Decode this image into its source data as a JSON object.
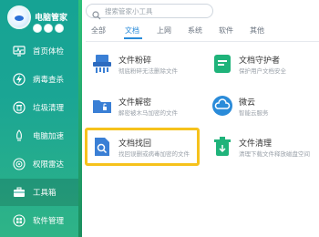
{
  "app": {
    "title": "电脑管家",
    "badge_count": 3
  },
  "sidebar": {
    "items": [
      {
        "label": "首页体检",
        "icon": "pulse-monitor-icon",
        "active": false
      },
      {
        "label": "病毒查杀",
        "icon": "lightning-icon",
        "active": false
      },
      {
        "label": "垃圾清理",
        "icon": "trash-icon",
        "active": false
      },
      {
        "label": "电脑加速",
        "icon": "rocket-icon",
        "active": false
      },
      {
        "label": "权限雷达",
        "icon": "radar-icon",
        "active": false
      },
      {
        "label": "工具箱",
        "icon": "toolbox-icon",
        "active": true
      },
      {
        "label": "软件管理",
        "icon": "app-grid-icon",
        "active": false
      }
    ]
  },
  "search": {
    "placeholder": "搜索管家小工具"
  },
  "tabs": [
    {
      "label": "全部",
      "active": false
    },
    {
      "label": "文档",
      "active": true
    },
    {
      "label": "上网",
      "active": false
    },
    {
      "label": "系统",
      "active": false
    },
    {
      "label": "软件",
      "active": false
    },
    {
      "label": "其他",
      "active": false
    }
  ],
  "tools": [
    {
      "title": "文件粉碎",
      "desc": "彻底粉碎无法删除文件",
      "icon": "shredder-icon",
      "color": "#3a7fd5"
    },
    {
      "title": "文档守护者",
      "desc": "保护用户文档安全",
      "icon": "doc-guard-icon",
      "color": "#1fb37a"
    },
    {
      "title": "文件解密",
      "desc": "解密被木马加密的文件",
      "icon": "folder-unlock-icon",
      "color": "#3a7fd5"
    },
    {
      "title": "微云",
      "desc": "智能云服务",
      "icon": "cloud-icon",
      "color": "#2a8bd9"
    },
    {
      "title": "文档找回",
      "desc": "找回误删或病毒加密的文件",
      "icon": "doc-search-icon",
      "color": "#3a7fd5"
    },
    {
      "title": "文件清理",
      "desc": "清理下载文件释放磁盘空间",
      "icon": "trash-bin-icon",
      "color": "#1fb37a"
    }
  ],
  "highlight": {
    "color": "#f6c21c"
  }
}
